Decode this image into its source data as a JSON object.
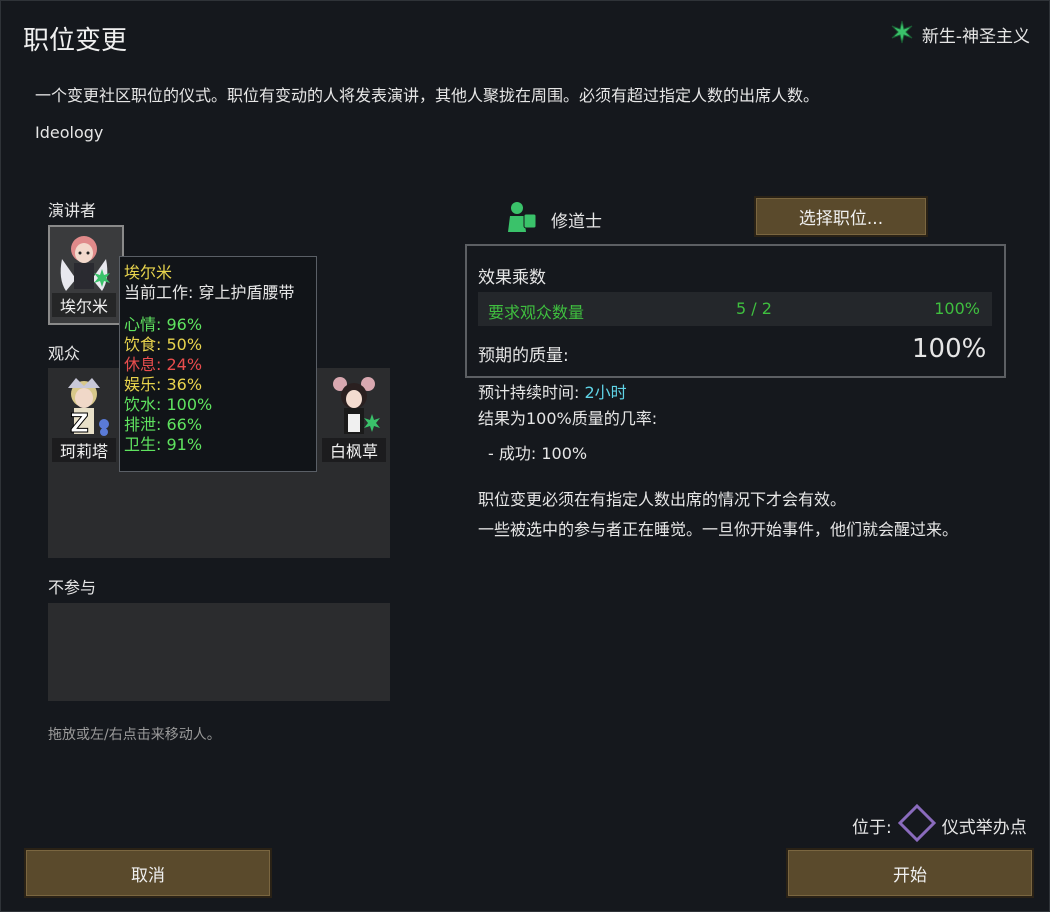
{
  "header": {
    "title": "职位变更",
    "ideoligion": "新生-神圣主义",
    "description": "一个变更社区职位的仪式。职位有变动的人将发表演讲，其他人聚拢在周围。必须有超过指定人数的出席人数。",
    "category": "Ideology"
  },
  "speaker": {
    "label": "演讲者",
    "pawn": "埃尔米"
  },
  "tooltip": {
    "name": "埃尔米",
    "job": "当前工作: 穿上护盾腰带",
    "stats": [
      {
        "text": "心情: 96%",
        "color": "#5fe35f"
      },
      {
        "text": "饮食: 50%",
        "color": "#e8d44d"
      },
      {
        "text": "休息: 24%",
        "color": "#e84d4d"
      },
      {
        "text": "娱乐: 36%",
        "color": "#e8d44d"
      },
      {
        "text": "饮水: 100%",
        "color": "#5fe35f"
      },
      {
        "text": "排泄: 66%",
        "color": "#5fe35f"
      },
      {
        "text": "卫生: 91%",
        "color": "#5fe35f"
      }
    ]
  },
  "audience": {
    "label": "观众",
    "pawns": [
      "珂莉塔",
      "白枫草"
    ]
  },
  "not_participating": {
    "label": "不参与"
  },
  "hint": "拖放或左/右点击来移动人。",
  "role": {
    "name": "修道士",
    "select_button": "选择职位..."
  },
  "quality": {
    "header": "效果乘数",
    "requirement_label": "要求观众数量",
    "requirement_count": "5 / 2",
    "requirement_pct": "100%",
    "expected_label": "预期的质量:",
    "expected_value": "100%"
  },
  "info": {
    "duration_label": "预计持续时间:",
    "duration_value": "2小时",
    "chance_label": "结果为100%质量的几率:",
    "success": "- 成功: 100%",
    "note1": "职位变更必须在有指定人数出席的情况下才会有效。",
    "note2": "一些被选中的参与者正在睡觉。一旦你开始事件，他们就会醒过来。"
  },
  "location": {
    "label": "位于:",
    "spot": "仪式举办点"
  },
  "buttons": {
    "cancel": "取消",
    "start": "开始"
  },
  "colors": {
    "accent_green": "#3fbf3f",
    "time_cyan": "#5fd3e6",
    "ideo_icon": "#3ac26a"
  }
}
